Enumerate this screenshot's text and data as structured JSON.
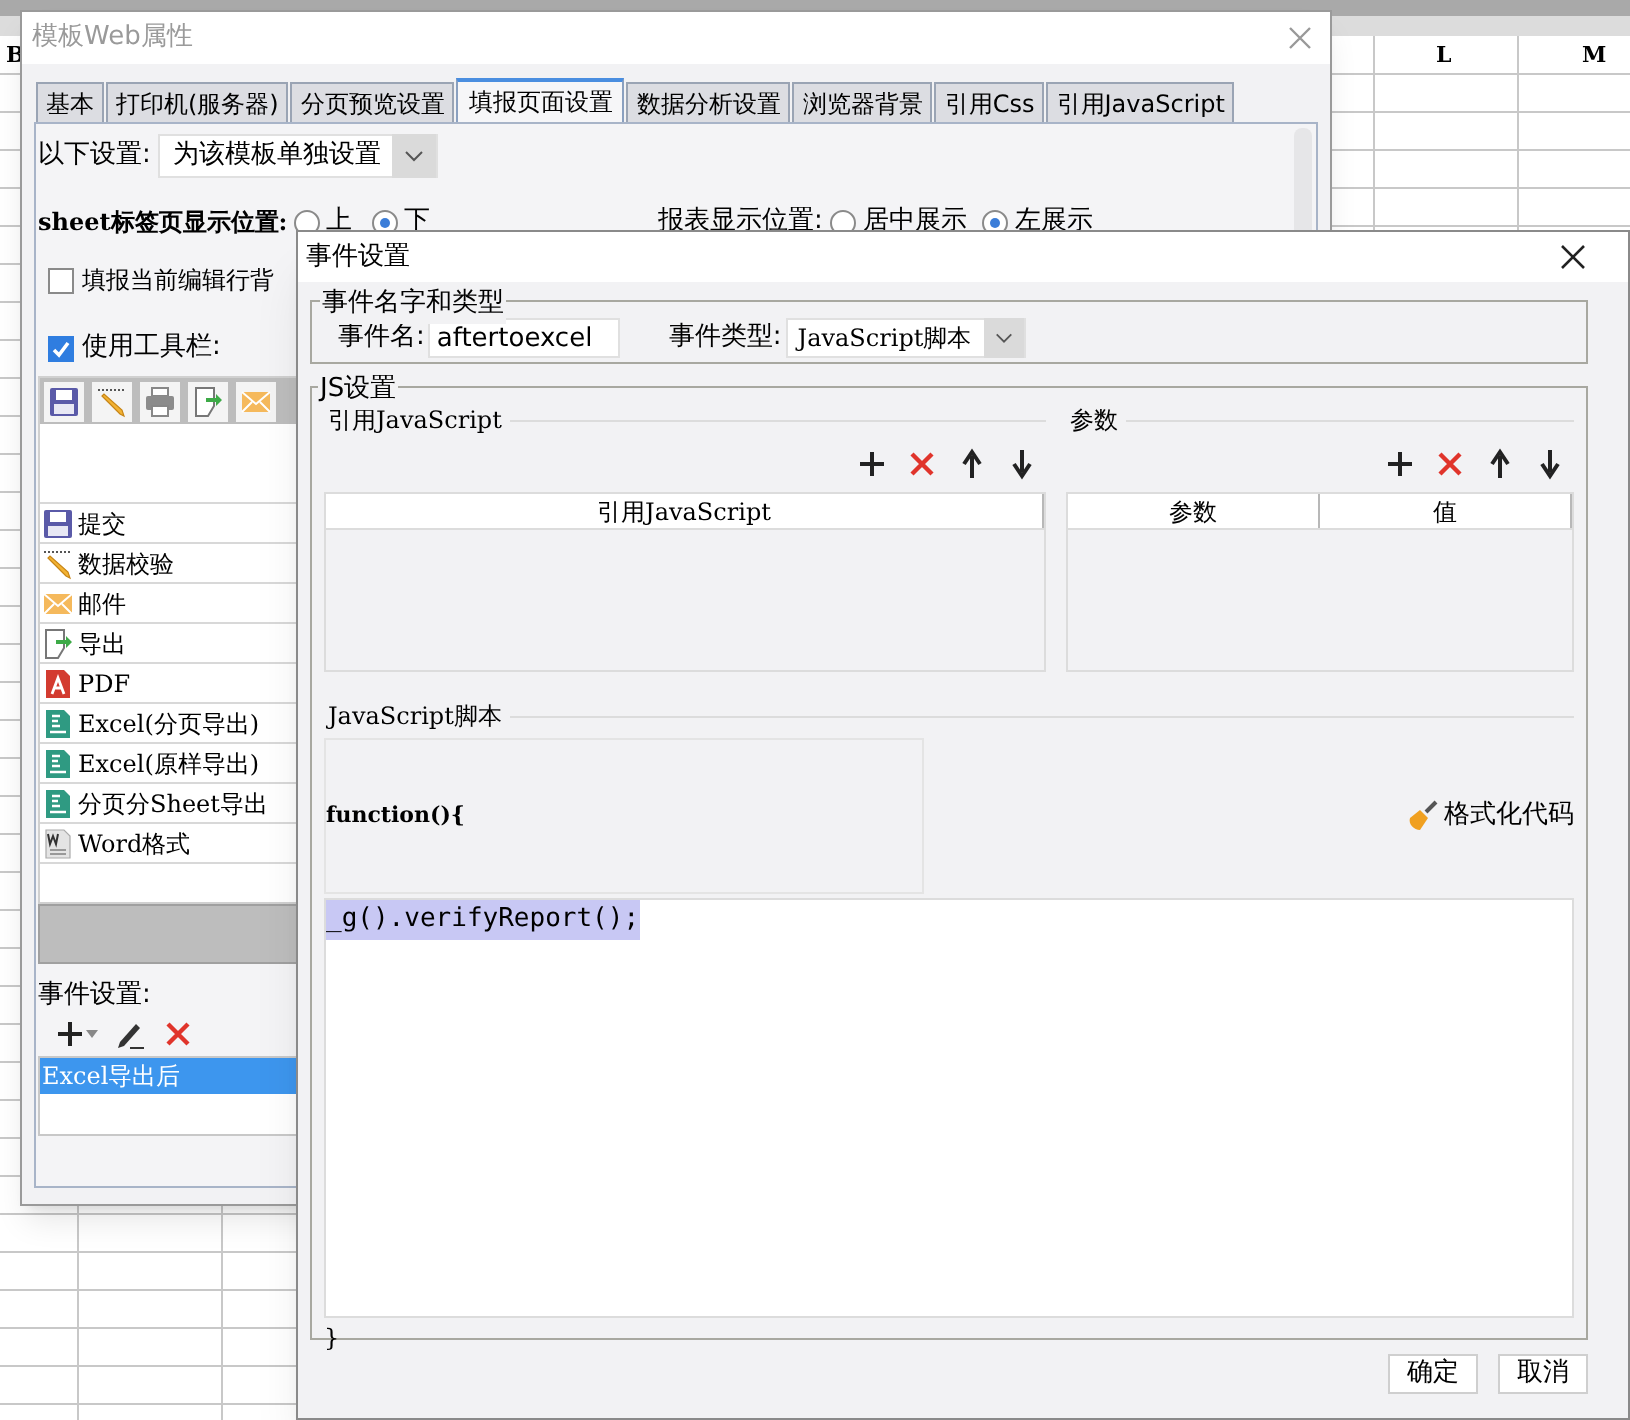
{
  "spreadsheet": {
    "column_headers": [
      "B",
      "L",
      "M"
    ]
  },
  "back_dialog": {
    "title": "模板Web属性",
    "tabs": [
      {
        "label": "基本",
        "selected": false
      },
      {
        "label": "打印机(服务器)",
        "selected": false
      },
      {
        "label": "分页预览设置",
        "selected": false
      },
      {
        "label": "填报页面设置",
        "selected": true
      },
      {
        "label": "数据分析设置",
        "selected": false
      },
      {
        "label": "浏览器背景",
        "selected": false
      },
      {
        "label": "引用Css",
        "selected": false
      },
      {
        "label": "引用JavaScript",
        "selected": false
      }
    ],
    "settings": {
      "label": "以下设置:",
      "value": "为该模板单独设置"
    },
    "sheet_tab_position": {
      "label": "sheet标签页显示位置:",
      "options": [
        {
          "label": "上",
          "selected": false
        },
        {
          "label": "下",
          "selected": true
        }
      ]
    },
    "report_position": {
      "label": "报表显示位置:",
      "options": [
        {
          "label": "居中展示",
          "selected": false
        },
        {
          "label": "左展示",
          "selected": true
        }
      ]
    },
    "highlight_row": {
      "label": "填报当前编辑行背",
      "checked": false
    },
    "use_toolbar": {
      "label": "使用工具栏:",
      "checked": true
    },
    "toolbar_items": [
      {
        "kind": "submit",
        "label": "提交"
      },
      {
        "kind": "verify",
        "label": "数据校验"
      },
      {
        "kind": "email",
        "label": "邮件"
      },
      {
        "kind": "export",
        "label": "导出"
      },
      {
        "kind": "pdf",
        "label": "PDF"
      },
      {
        "kind": "excel",
        "label": "Excel(分页导出)"
      },
      {
        "kind": "excel",
        "label": "Excel(原样导出)"
      },
      {
        "kind": "excel",
        "label": "分页分Sheet导出"
      },
      {
        "kind": "word",
        "label": "Word格式"
      }
    ],
    "event_settings": {
      "label": "事件设置:",
      "events": [
        {
          "label": "Excel导出后",
          "selected": true
        }
      ]
    }
  },
  "front_dialog": {
    "title": "事件设置",
    "name_type_group": {
      "title": "事件名字和类型",
      "name_label": "事件名:",
      "name_value": "aftertoexcel",
      "type_label": "事件类型:",
      "type_value": "JavaScript脚本"
    },
    "js_group": {
      "title": "JS设置",
      "reference": {
        "title": "引用JavaScript",
        "columns": [
          "引用JavaScript"
        ]
      },
      "params": {
        "title": "参数",
        "columns": [
          "参数",
          "值"
        ]
      },
      "script": {
        "title": "JavaScript脚本",
        "header": "function(){",
        "body": "_g().verifyReport();",
        "footer": "}",
        "format_button": "格式化代码"
      }
    },
    "buttons": [
      "确定",
      "取消"
    ]
  }
}
